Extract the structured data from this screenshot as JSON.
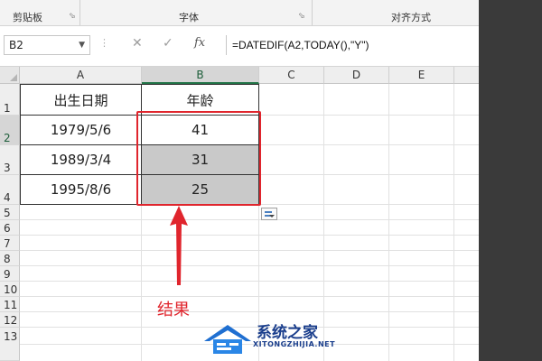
{
  "ribbon": {
    "groups": [
      {
        "label": "剪贴板"
      },
      {
        "label": "字体"
      },
      {
        "label": "对齐方式"
      }
    ]
  },
  "formula_bar": {
    "name_box": "B2",
    "formula": "=DATEDIF(A2,TODAY(),\"Y\")",
    "fx_label": "fx"
  },
  "sheet": {
    "columns": [
      "A",
      "B",
      "C",
      "D",
      "E"
    ],
    "selected_column": "B",
    "rows": [
      "1",
      "2",
      "3",
      "4",
      "5",
      "6",
      "7",
      "8",
      "9",
      "10",
      "11",
      "12",
      "13"
    ],
    "header": {
      "a": "出生日期",
      "b": "年龄"
    },
    "data": [
      {
        "birth": "1979/5/6",
        "age": "41"
      },
      {
        "birth": "1989/3/4",
        "age": "31"
      },
      {
        "birth": "1995/8/6",
        "age": "25"
      }
    ]
  },
  "annotation": {
    "label": "结果",
    "color": "#e0252d"
  },
  "watermark": {
    "title": "系统之家",
    "subtitle": "XITONGZHIJIA.NET"
  },
  "colors": {
    "selection_green": "#217346",
    "highlight_red": "#e0252d",
    "shaded_cell": "#c9c9c9"
  }
}
